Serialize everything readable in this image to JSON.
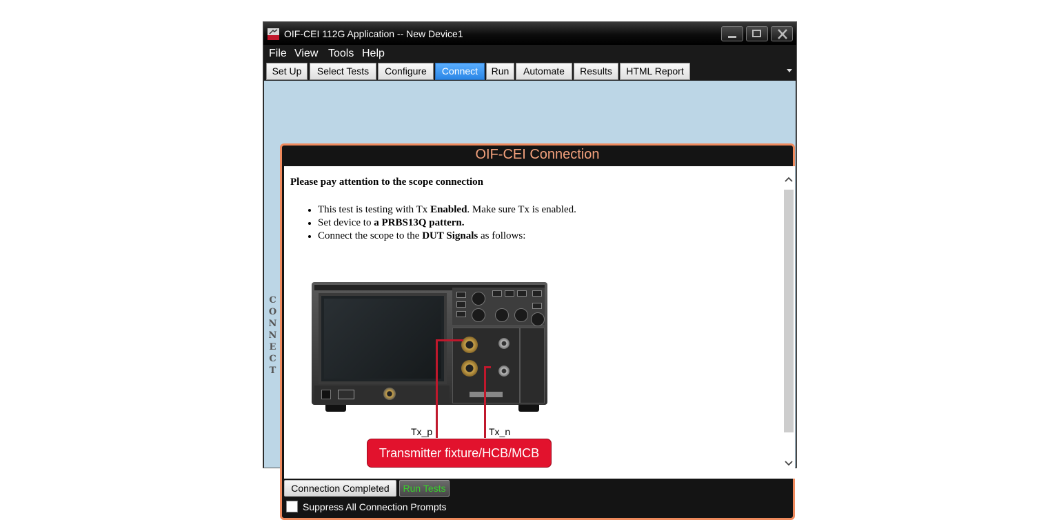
{
  "window": {
    "title": "OIF-CEI 112G Application -- New Device1"
  },
  "menu": [
    "File",
    "View",
    "Tools",
    "Help"
  ],
  "tabs": [
    {
      "label": "Set Up",
      "active": false
    },
    {
      "label": "Select Tests",
      "active": false
    },
    {
      "label": "Configure",
      "active": false
    },
    {
      "label": "Connect",
      "active": true
    },
    {
      "label": "Run",
      "active": false
    },
    {
      "label": "Automate",
      "active": false
    },
    {
      "label": "Results",
      "active": false
    },
    {
      "label": "HTML Report",
      "active": false
    }
  ],
  "side_label": "CONNECT",
  "panel": {
    "title": "OIF-CEI Connection",
    "heading": "Please pay attention to the scope connection",
    "bullets": [
      {
        "pre": "This test is testing with Tx ",
        "bold": "Enabled",
        "post": ". Make sure Tx is enabled."
      },
      {
        "pre": "Set device to ",
        "bold": "a PRBS13Q pattern.",
        "post": ""
      },
      {
        "pre": "Connect the scope to the ",
        "bold": "DUT Signals",
        "post": " as follows:"
      }
    ],
    "diagram": {
      "tx_p": "Tx_p",
      "tx_n": "Tx_n",
      "fixture": "Transmitter fixture/HCB/MCB"
    }
  },
  "footer": {
    "connection_completed": "Connection Completed",
    "run_tests": "Run Tests",
    "suppress_label": "Suppress All Connection Prompts",
    "suppress_checked": false
  },
  "colors": {
    "accent_title": "#f4a27d",
    "panel_border": "#f08a5d",
    "active_tab": "#2a86e6",
    "fixture_red": "#e2122d",
    "run_tests_text": "#39d12b"
  }
}
